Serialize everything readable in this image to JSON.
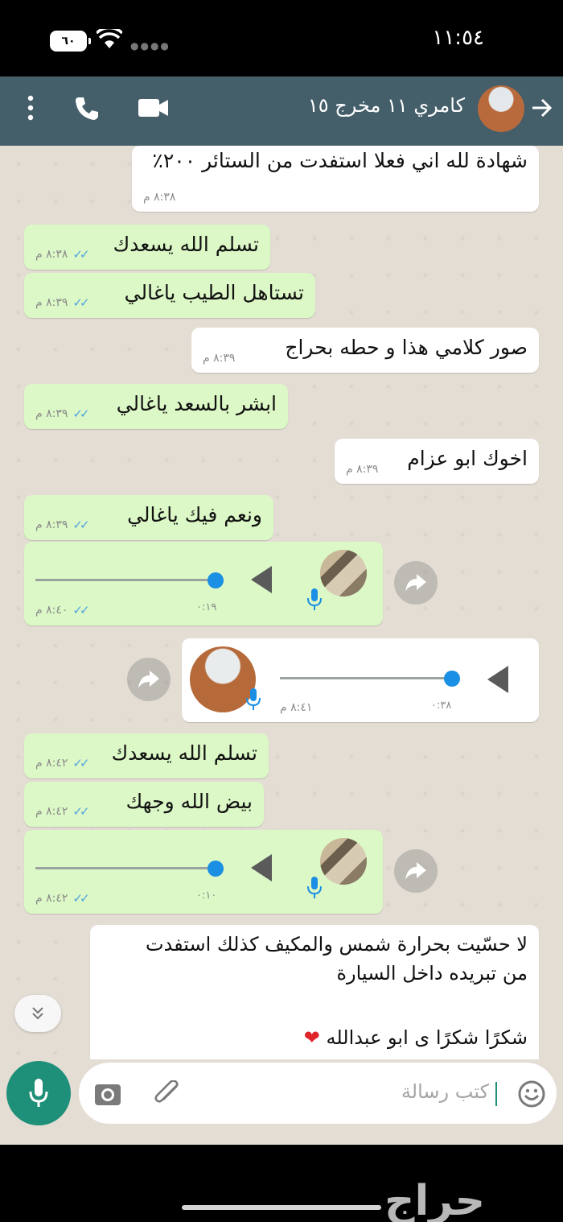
{
  "status_bar": {
    "time": "١١:٥٤",
    "battery": "٦٠"
  },
  "header": {
    "title": "كامري ١١ مخرج ١٥"
  },
  "messages": [
    {
      "text": "شهادة لله اني فعلا استفدت من الستائر ٢٠٠٪",
      "time": "٨:٣٨ م"
    },
    {
      "text": "تسلم الله يسعدك",
      "time": "٨:٣٨ م"
    },
    {
      "text": "تستاهل الطيب ياغالي",
      "time": "٨:٣٩ م"
    },
    {
      "text": "صور كلامي هذا و حطه بحراج",
      "time": "٨:٣٩ م"
    },
    {
      "text": "ابشر بالسعد ياغالي",
      "time": "٨:٣٩ م"
    },
    {
      "text": "اخوك ابو عزام",
      "time": "٨:٣٩ م"
    },
    {
      "text": "ونعم فيك ياغالي",
      "time": "٨:٣٩ م"
    },
    {
      "duration": "٠:١٩",
      "time": "٨:٤٠ م"
    },
    {
      "duration": "٠:٣٨",
      "time": "٨:٤١ م"
    },
    {
      "text": "تسلم الله يسعدك",
      "time": "٨:٤٢ م"
    },
    {
      "text": "بيض الله وجهك",
      "time": "٨:٤٢ م"
    },
    {
      "duration": "٠:١٠",
      "time": "٨:٤٢ م"
    },
    {
      "lines": [
        "لا حسّيت بحرارة شمس والمكيف كذلك استفدت",
        "من تبريده داخل السيارة",
        "شكرًا شكرًا ى ابو عبدالله"
      ]
    }
  ],
  "input": {
    "placeholder": "كتب رسالة"
  },
  "watermark": "حراج",
  "colors": {
    "header": "#445e6a",
    "outgoing": "#dcf8c6",
    "incoming": "#ffffff",
    "accent": "#1e8f78",
    "read_ticks": "#4fa3e0"
  }
}
